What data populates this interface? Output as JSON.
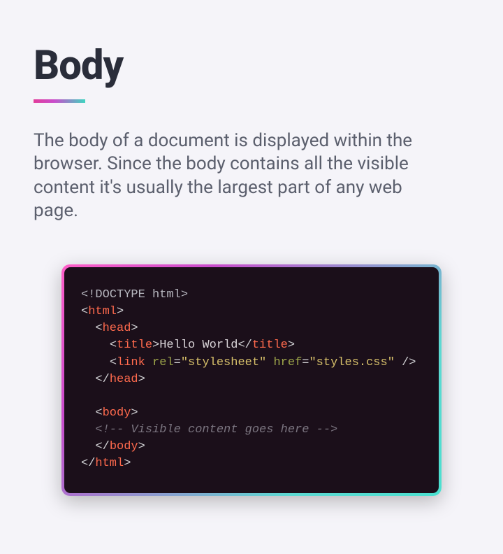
{
  "title": "Body",
  "description": "The body of a document is displayed within the browser. Since the body contains all the visible content it's usually the largest part of any web page.",
  "code": {
    "l1": {
      "doctype": "<!DOCTYPE html>"
    },
    "l2": {
      "open": "<",
      "tag": "html",
      "close": ">"
    },
    "l3": {
      "open": "<",
      "tag": "head",
      "close": ">"
    },
    "l4": {
      "open": "<",
      "tag": "title",
      "close": ">",
      "text": "Hello World",
      "open2": "</",
      "tag2": "title",
      "close2": ">"
    },
    "l5": {
      "open": "<",
      "tag": "link",
      "attr1": "rel",
      "eq1": "=",
      "val1": "\"stylesheet\"",
      "attr2": "href",
      "eq2": "=",
      "val2": "\"styles.css\"",
      "close": " />"
    },
    "l6": {
      "open": "</",
      "tag": "head",
      "close": ">"
    },
    "l7": {
      "open": "<",
      "tag": "body",
      "close": ">"
    },
    "l8": {
      "comment": "<!-- Visible content goes here -->"
    },
    "l9": {
      "open": "</",
      "tag": "body",
      "close": ">"
    },
    "l10": {
      "open": "</",
      "tag": "html",
      "close": ">"
    }
  }
}
